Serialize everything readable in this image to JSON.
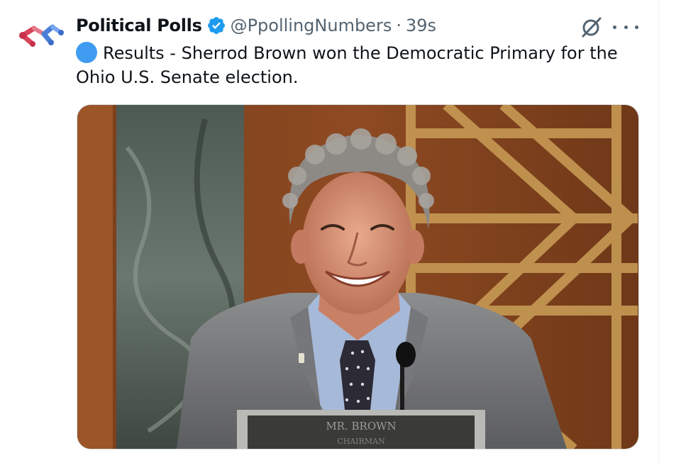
{
  "tweet": {
    "display_name": "Political Polls",
    "handle": "@PpollingNumbers",
    "separator": "·",
    "time": "39s",
    "text": "Results - Sherrod Brown won the Democratic Primary for the Ohio U.S. Senate election.",
    "text_line1": "Results - Sherrod Brown won the Democratic Primary for the",
    "text_line2": "Ohio U.S. Senate election."
  },
  "media": {
    "nameplate_line1": "MR. BROWN",
    "nameplate_line2": "CHAIRMAN"
  },
  "icons": {
    "verified": "verified-badge-icon",
    "grok": "grok-icon",
    "more": "more-options-icon",
    "status_dot": "blue-circle-emoji"
  },
  "colors": {
    "verified": "#1d9bf0",
    "status_dot": "#3f9cf0",
    "secondary_text": "#536471"
  }
}
